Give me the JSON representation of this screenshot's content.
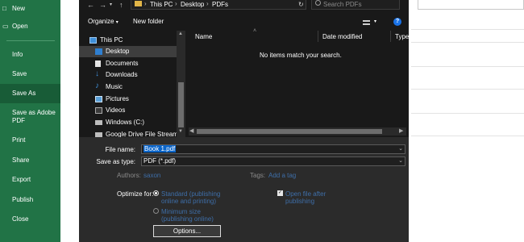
{
  "backstage": {
    "items": [
      {
        "label": "New",
        "icon": "new-document-icon"
      },
      {
        "label": "Open",
        "icon": "folder-open-icon"
      },
      {
        "label": "Info"
      },
      {
        "label": "Save"
      },
      {
        "label": "Save As",
        "active": true
      },
      {
        "label": "Save as Adobe",
        "label2": "PDF"
      },
      {
        "label": "Print"
      },
      {
        "label": "Share"
      },
      {
        "label": "Export"
      },
      {
        "label": "Publish"
      },
      {
        "label": "Close"
      }
    ]
  },
  "dialog": {
    "address": {
      "crumbs": [
        "This PC",
        "Desktop",
        "PDFs"
      ],
      "search_placeholder": "Search PDFs"
    },
    "toolbar": {
      "organize": "Organize",
      "new_folder": "New folder"
    },
    "nav": {
      "items": [
        {
          "label": "This PC",
          "icon": "computer-icon"
        },
        {
          "label": "Desktop",
          "icon": "desktop-folder-icon",
          "selected": true
        },
        {
          "label": "Documents",
          "icon": "documents-icon"
        },
        {
          "label": "Downloads",
          "icon": "downloads-icon"
        },
        {
          "label": "Music",
          "icon": "music-icon"
        },
        {
          "label": "Pictures",
          "icon": "pictures-icon"
        },
        {
          "label": "Videos",
          "icon": "videos-icon"
        },
        {
          "label": "Windows (C:)",
          "icon": "drive-icon"
        },
        {
          "label": "Google Drive File Stream (G",
          "icon": "drive-icon"
        }
      ]
    },
    "columns": [
      "Name",
      "Date modified",
      "Type"
    ],
    "empty_message": "No items match your search.",
    "form": {
      "file_name_label": "File name:",
      "file_name_value": "Book 1.pdf",
      "save_type_label": "Save as type:",
      "save_type_value": "PDF (*.pdf)",
      "authors_label": "Authors:",
      "authors_value": "saxon",
      "tags_label": "Tags:",
      "tags_value": "Add a tag",
      "optimize_label": "Optimize for:",
      "opt_standard_1": "Standard (publishing",
      "opt_standard_2": "online and printing)",
      "opt_minimum_1": "Minimum size",
      "opt_minimum_2": "(publishing online)",
      "open_after_1": "Open file after",
      "open_after_2": "publishing",
      "options_button": "Options..."
    }
  },
  "colors": {
    "excel_green": "#217346",
    "excel_green_active": "#185c37",
    "dialog_bg": "#191919",
    "form_bg": "#2b2b2b",
    "link_blue": "#4c8fdd",
    "selection_blue": "#0a64c8"
  }
}
